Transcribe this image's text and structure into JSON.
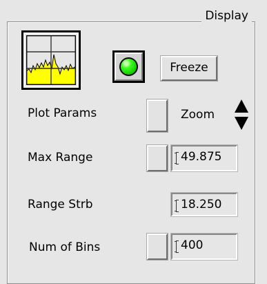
{
  "panel": {
    "title": "Display"
  },
  "plot_button": {
    "icon": "waveform-plot-icon",
    "fill_color": "#ffff00"
  },
  "status_led": {
    "icon": "green-led-icon",
    "color": "#22dd00"
  },
  "freeze": {
    "label": "Freeze"
  },
  "plot_params": {
    "label": "Plot Params"
  },
  "zoom": {
    "label": "Zoom",
    "icon": "up-down-arrow-icon"
  },
  "max_range": {
    "label": "Max Range",
    "value": "49.875"
  },
  "range_strb": {
    "label": "Range Strb",
    "value": "18.250"
  },
  "num_bins": {
    "label": "Num of Bins",
    "value": "400"
  }
}
